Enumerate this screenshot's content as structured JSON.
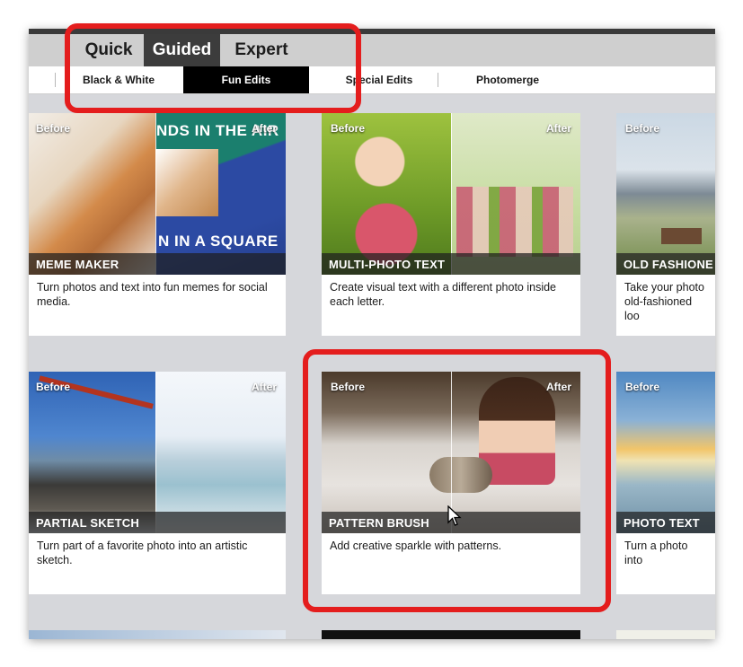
{
  "mode_tabs": [
    "Quick",
    "Guided",
    "Expert"
  ],
  "sub_tabs": [
    "Black & White",
    "Fun Edits",
    "Special Edits",
    "Photomerge"
  ],
  "labels": {
    "before": "Before",
    "after": "After"
  },
  "cards": [
    {
      "title": "MEME MAKER",
      "description": "Turn photos and text into fun memes for social media.",
      "overlay_top": "NDS IN THE AIR",
      "overlay_bottom": "N IN A SQUARE"
    },
    {
      "title": "MULTI-PHOTO TEXT",
      "description": "Create visual text with a different photo inside each letter."
    },
    {
      "title": "OLD FASHIONE",
      "description": "Take your photo old-fashioned loo"
    },
    {
      "title": "PARTIAL SKETCH",
      "description": "Turn part of a favorite photo into an artistic sketch."
    },
    {
      "title": "PATTERN BRUSH",
      "description": "Add creative sparkle with patterns."
    },
    {
      "title": "PHOTO TEXT",
      "description": "Turn a photo into"
    }
  ],
  "colors": {
    "highlight": "#e41d1d",
    "active_tab": "#3c3c3c",
    "active_subtab": "#000000"
  }
}
